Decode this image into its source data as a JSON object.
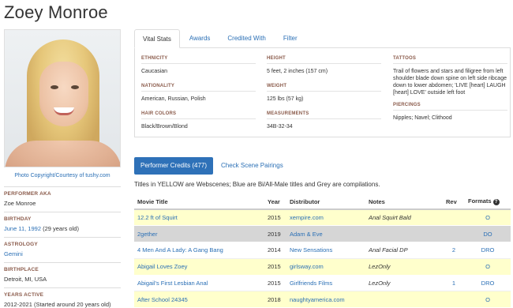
{
  "performer": {
    "name": "Zoey Monroe"
  },
  "photo_credit": "Photo Copyright/Courtesy of tushy.com",
  "bio": [
    {
      "label": "Performer AKA",
      "value": "Zoe Monroe",
      "link": false
    },
    {
      "label": "Birthday",
      "value": "June 11, 1992",
      "extra": " (29 years old)",
      "link": true
    },
    {
      "label": "Astrology",
      "value": "Gemini",
      "link": true
    },
    {
      "label": "Birthplace",
      "value": "Detroit, MI, USA",
      "link": false
    },
    {
      "label": "Years Active",
      "value": "2012-2021 (Started around 20 years old)",
      "link": false
    }
  ],
  "tabs": [
    {
      "label": "Vital Stats",
      "active": true
    },
    {
      "label": "Awards",
      "active": false
    },
    {
      "label": "Credited With",
      "active": false
    },
    {
      "label": "Filter",
      "active": false
    }
  ],
  "vitals": {
    "col1": [
      {
        "label": "Ethnicity",
        "value": "Caucasian"
      },
      {
        "label": "Nationality",
        "value": "American, Russian, Polish"
      },
      {
        "label": "Hair Colors",
        "value": "Black/Brown/Blond"
      }
    ],
    "col2": [
      {
        "label": "Height",
        "value": "5 feet, 2 inches (157 cm)"
      },
      {
        "label": "Weight",
        "value": "125 lbs (57 kg)"
      },
      {
        "label": "Measurements",
        "value": "34B-32-34"
      }
    ],
    "col3": [
      {
        "label": "Tattoos",
        "value": "Trail of flowers and stars and filigree from left shoulder blade down spine on left side ribcage down to lower abdomen; 'LIVE [heart] LAUGH [heart] LOVE' outside left foot"
      },
      {
        "label": "Piercings",
        "value": "Nipples; Navel; Clithood"
      }
    ]
  },
  "credits": {
    "button_label": "Performer Credits (477)",
    "pairings_label": "Check Scene Pairings",
    "legend": "Titles in YELLOW are Webscenes; Blue are Bi/All-Male titles and Grey are compilations.",
    "columns": {
      "title": "Movie Title",
      "year": "Year",
      "distributor": "Distributor",
      "notes": "Notes",
      "rev": "Rev",
      "formats": "Formats"
    },
    "rows": [
      {
        "title": "12.2 ft of Squirt",
        "year": "2015",
        "distributor": "xempire.com",
        "notes": "Anal Squirt Bald",
        "rev": "",
        "formats": "O",
        "style": "yellow"
      },
      {
        "title": "2gether",
        "year": "2019",
        "distributor": "Adam & Eve",
        "notes": "",
        "rev": "",
        "formats": "DO",
        "style": "grey"
      },
      {
        "title": "4 Men And A Lady: A Gang Bang",
        "year": "2014",
        "distributor": "New Sensations",
        "notes": "Anal Facial DP",
        "rev": "2",
        "formats": "DRO",
        "style": "white"
      },
      {
        "title": "Abigail Loves Zoey",
        "year": "2015",
        "distributor": "girlsway.com",
        "notes": "LezOnly",
        "rev": "",
        "formats": "O",
        "style": "yellow"
      },
      {
        "title": "Abigail's First Lesbian Anal",
        "year": "2015",
        "distributor": "Girlfriends Films",
        "notes": "LezOnly",
        "rev": "1",
        "formats": "DRO",
        "style": "white"
      },
      {
        "title": "After School 24345",
        "year": "2018",
        "distributor": "naughtyamerica.com",
        "notes": "",
        "rev": "",
        "formats": "O",
        "style": "yellow"
      }
    ]
  },
  "colors": {
    "link": "#2a6fb5",
    "button": "#2e71b8",
    "webscene": "#ffffcc",
    "compilation": "#d6d6d6",
    "label": "#8a5a4a"
  },
  "icons": {
    "formats_help": "question-circle-icon"
  }
}
